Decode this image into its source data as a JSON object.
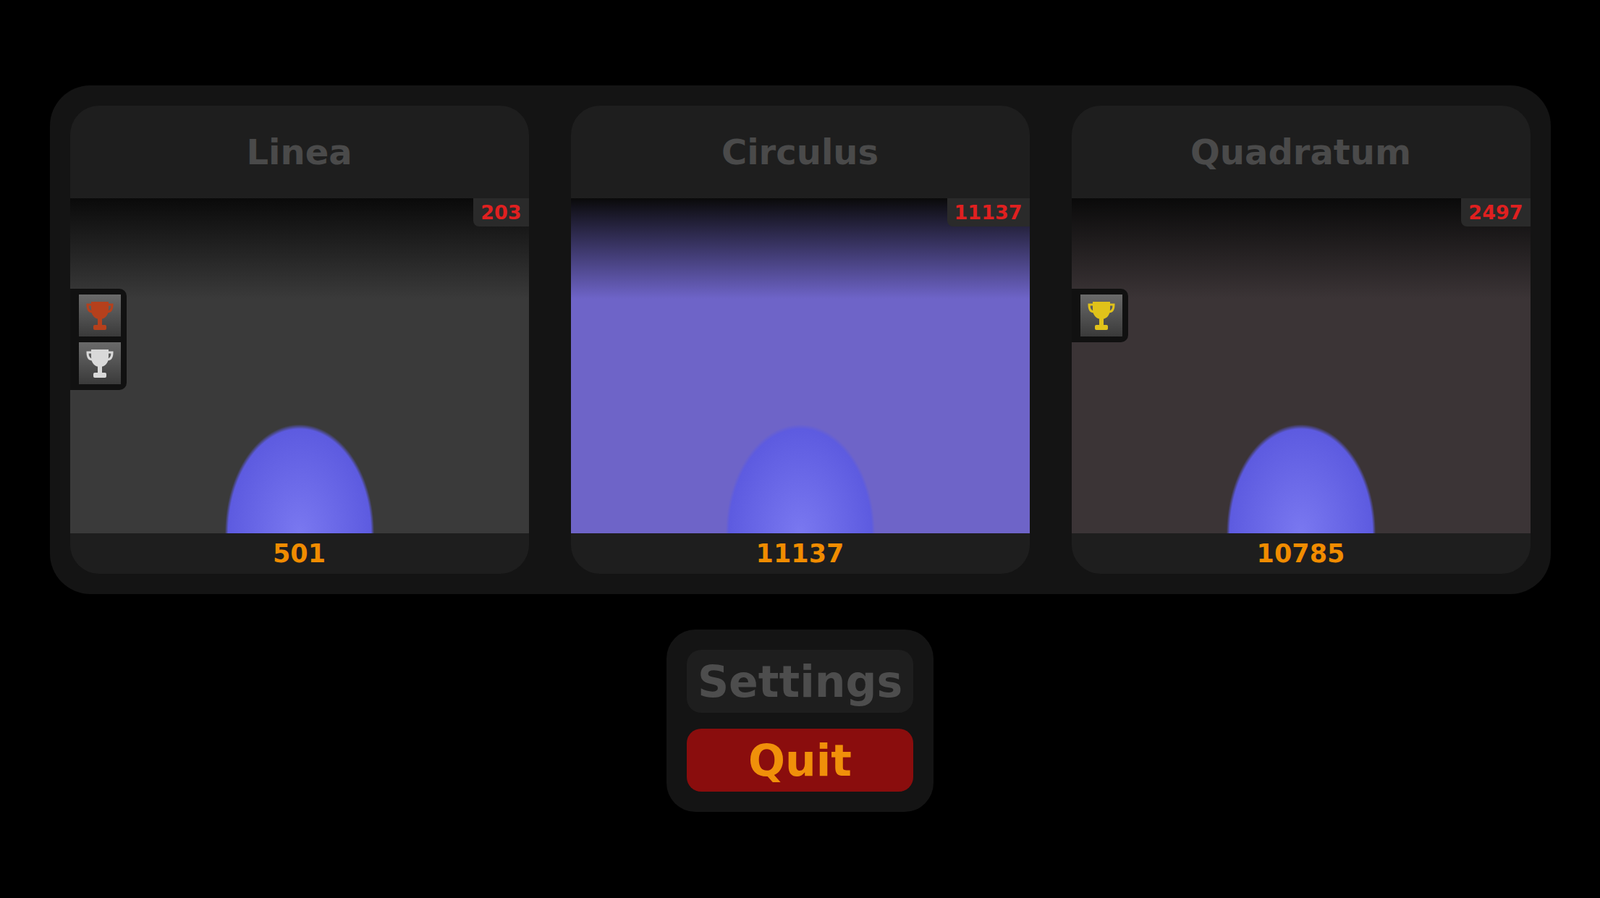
{
  "levels": [
    {
      "title": "Linea",
      "badge": "203",
      "score": "501",
      "color": "#3a3a3a",
      "trophies": [
        {
          "color": "#b5401c"
        },
        {
          "color": "#d9d9d9"
        }
      ]
    },
    {
      "title": "Circulus",
      "badge": "11137",
      "score": "11137",
      "color": "#6e64c8",
      "trophies": []
    },
    {
      "title": "Quadratum",
      "badge": "2497",
      "score": "10785",
      "color": "#3b3436",
      "trophies": [
        {
          "color": "#e0c21a"
        }
      ]
    }
  ],
  "menu": [
    {
      "label": "Settings",
      "kind": "secondary"
    },
    {
      "label": "Quit",
      "kind": "primary"
    }
  ]
}
